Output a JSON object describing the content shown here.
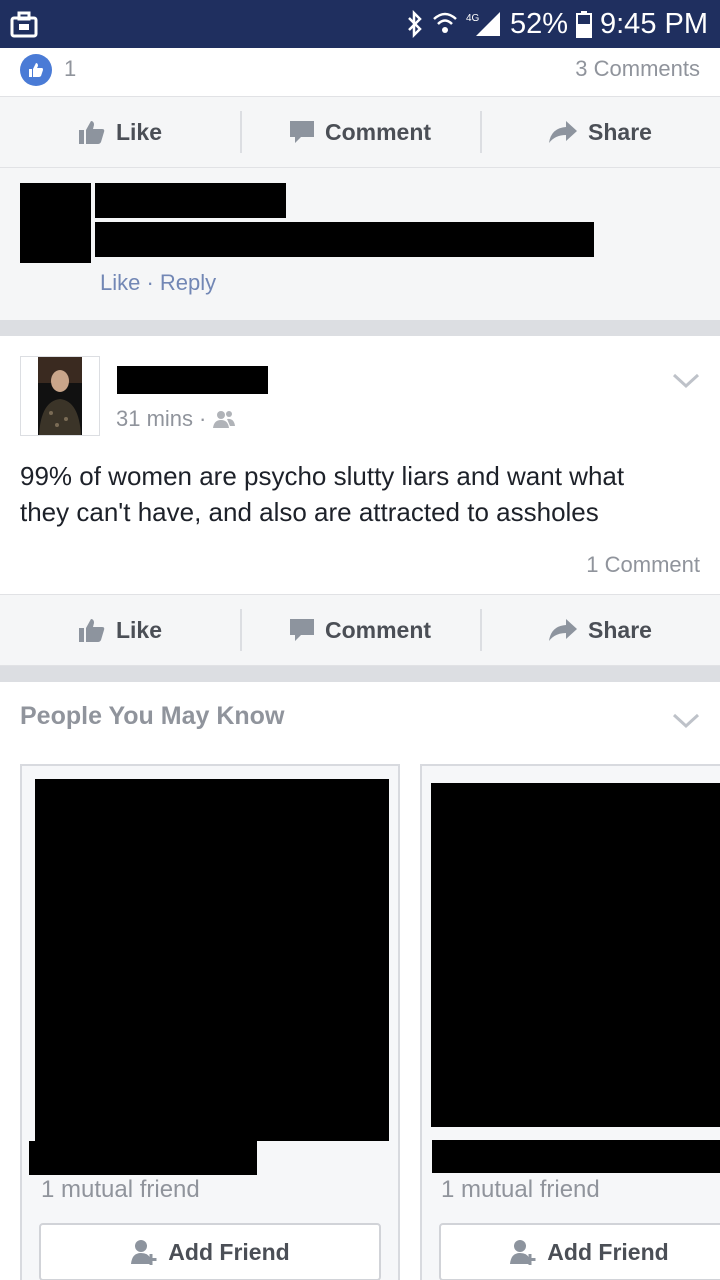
{
  "status_bar": {
    "battery": "52%",
    "time": "9:45 PM",
    "network": "4G"
  },
  "post1": {
    "like_count": "1",
    "comments_count": "3 Comments"
  },
  "actions": {
    "like": "Like",
    "comment": "Comment",
    "share": "Share"
  },
  "comment": {
    "like_reply": "Like · Reply"
  },
  "post2": {
    "time": "31 mins",
    "separator": "·",
    "text_line1": "99% of women are psycho slutty liars and want what",
    "text_line2": "they can't have, and also are attracted to assholes",
    "comments_count": "1 Comment"
  },
  "pymk": {
    "title": "People You May Know",
    "cards": [
      {
        "mutual": "1 mutual friend",
        "button": "Add Friend"
      },
      {
        "mutual": "1 mutual friend",
        "button": "Add Friend"
      }
    ]
  },
  "colors": {
    "status_bar": "#1f2f5f",
    "like_blue": "#4267b2",
    "link": "#7287b5"
  }
}
